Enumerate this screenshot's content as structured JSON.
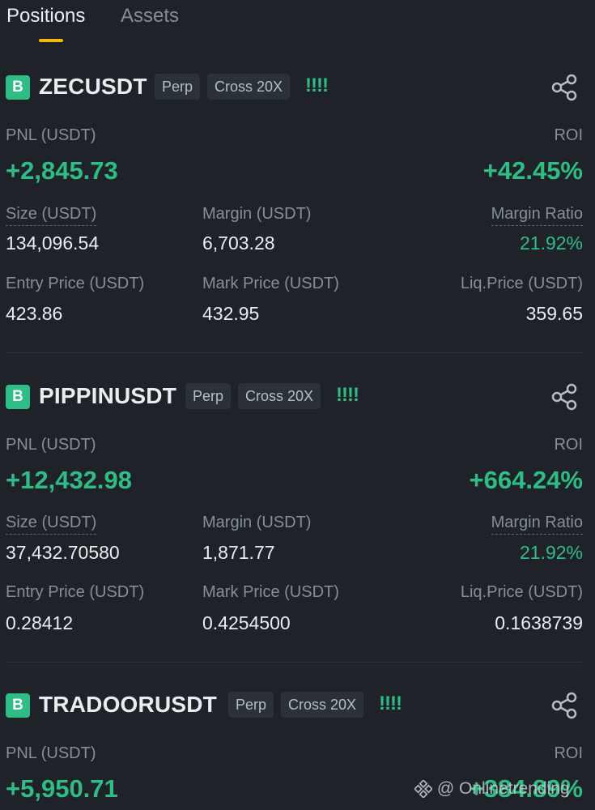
{
  "tabs": {
    "positions": "Positions",
    "assets": "Assets"
  },
  "labels": {
    "pnl": "PNL (USDT)",
    "roi": "ROI",
    "size": "Size (USDT)",
    "margin": "Margin (USDT)",
    "margin_ratio": "Margin Ratio",
    "entry_price": "Entry Price (USDT)",
    "mark_price": "Mark Price (USDT)",
    "liq_price": "Liq.Price (USDT)"
  },
  "positions": [
    {
      "side_badge": "B",
      "symbol": "ZECUSDT",
      "type": "Perp",
      "leverage": "Cross 20X",
      "signal": "!!!!",
      "pnl": "+2,845.73",
      "roi": "+42.45%",
      "size": "134,096.54",
      "margin": "6,703.28",
      "margin_ratio": "21.92%",
      "entry_price": "423.86",
      "mark_price": "432.95",
      "liq_price": "359.65"
    },
    {
      "side_badge": "B",
      "symbol": "PIPPINUSDT",
      "type": "Perp",
      "leverage": "Cross 20X",
      "signal": "!!!!",
      "pnl": "+12,432.98",
      "roi": "+664.24%",
      "size": "37,432.70580",
      "margin": "1,871.77",
      "margin_ratio": "21.92%",
      "entry_price": "0.28412",
      "mark_price": "0.4254500",
      "liq_price": "0.1638739"
    },
    {
      "side_badge": "B",
      "symbol": "TRADOORUSDT",
      "type": "Perp",
      "leverage": "Cross 20X",
      "signal": "!!!!",
      "pnl": "+5,950.71",
      "roi": "+384.89%"
    }
  ],
  "watermark": "@ Onlinetrending",
  "colors": {
    "background": "#1f2329",
    "profit_green": "#2ebd85",
    "accent_yellow": "#f0b90b",
    "muted_text": "#848e9c"
  },
  "icons": {
    "share": "share-icon",
    "watermark": "binance-logo-icon"
  }
}
